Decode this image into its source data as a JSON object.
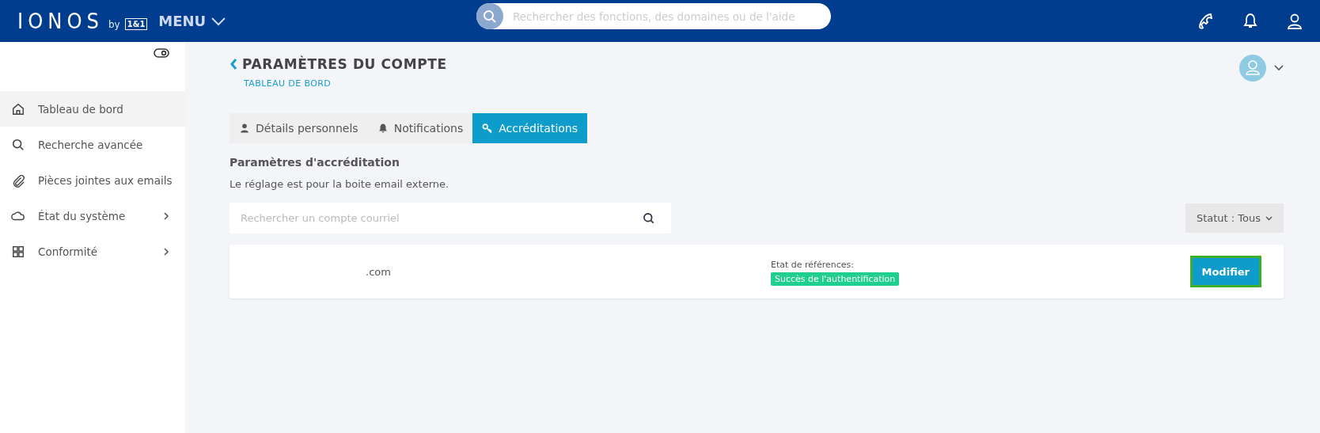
{
  "header": {
    "logo": "IONOS",
    "logo_by": "by",
    "logo_partner": "1&1",
    "menu": "MENU",
    "search": {
      "placeholder": "Rechercher des fonctions, des domaines ou de l'aide"
    }
  },
  "sidebar": {
    "items": [
      {
        "label": "Tableau de bord",
        "kind": "link",
        "selected": true
      },
      {
        "label": "Recherche avancée",
        "kind": "link",
        "selected": false
      },
      {
        "label": "Pièces jointes aux emails",
        "kind": "link",
        "selected": false
      },
      {
        "label": "État du système",
        "kind": "group",
        "selected": false
      },
      {
        "label": "Conformité",
        "kind": "group",
        "selected": false
      }
    ]
  },
  "page": {
    "title": "PARAMÈTRES DU COMPTE",
    "breadcrumb": "TABLEAU DE BORD"
  },
  "tabs": [
    {
      "label": "Détails personnels",
      "selected": false
    },
    {
      "label": "Notifications",
      "selected": false
    },
    {
      "label": "Accréditations",
      "selected": true
    }
  ],
  "section": {
    "title": "Paramètres d'accréditation",
    "description": "Le réglage est pour la boite email externe."
  },
  "account_search": {
    "placeholder": "Rechercher un compte courriel"
  },
  "status_filter": "Statut : Tous",
  "accounts": [
    {
      "email": ".com",
      "status_label": "Etat de références:",
      "status": "Succès de l'authentification",
      "action": "Modifier"
    }
  ]
}
